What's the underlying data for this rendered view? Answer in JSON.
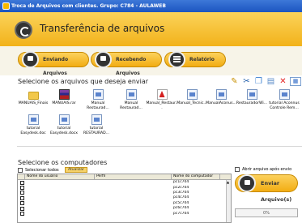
{
  "window": {
    "title": "Troca de Arquivos com clientes.    Grupo: C784 - AULAWEB"
  },
  "header": {
    "title": "Transferência de arquivos"
  },
  "tabs": [
    {
      "label": "Enviando Arquivos"
    },
    {
      "label": "Recebendo Arquivos"
    },
    {
      "label": "Relatório"
    }
  ],
  "files_section": {
    "label": "Selecione os arquivos que deseja enviar",
    "toolbar_icons": [
      "edit-icon",
      "cut-icon",
      "copy-icon",
      "paste-icon",
      "delete-icon",
      "view-icon",
      "dropdown-icon"
    ],
    "files": [
      {
        "name": "MANUAIS_Finais",
        "icon": "folder"
      },
      {
        "name": "MANUAIS.rar",
        "icon": "rar"
      },
      {
        "name": "Manual Restaurad...",
        "icon": "doc"
      },
      {
        "name": "Manual Restaurad...",
        "icon": "doc"
      },
      {
        "name": "Manual_Restaur...",
        "icon": "pdf"
      },
      {
        "name": "Manual_Tecnic...",
        "icon": "doc"
      },
      {
        "name": "ManualAconus...",
        "icon": "doc"
      },
      {
        "name": "RestauradorWi...",
        "icon": "doc"
      },
      {
        "name": "tutorial Aconnus Controle Rem...",
        "icon": "doc"
      },
      {
        "name": "tutorial Easydesk.doc",
        "icon": "doc"
      },
      {
        "name": "tutorial Easydesk.docx",
        "icon": "doc"
      },
      {
        "name": "tutorial RESTAURAD...",
        "icon": "doc"
      }
    ]
  },
  "computers_section": {
    "label": "Selecione os computadores",
    "select_all_label": "Selecionar todos",
    "refresh_label": "Atualizar",
    "columns": [
      "",
      "Nome do usuário",
      "Perfil",
      "Nome do computador"
    ],
    "rows": [
      {
        "user": "",
        "profile": "",
        "computer": "pc1c704"
      },
      {
        "user": "",
        "profile": "",
        "computer": "pc2c704"
      },
      {
        "user": "",
        "profile": "",
        "computer": "pc3c704"
      },
      {
        "user": "",
        "profile": "",
        "computer": "pc4c704"
      },
      {
        "user": "",
        "profile": "",
        "computer": "pc5c704"
      },
      {
        "user": "",
        "profile": "",
        "computer": "pc6c704"
      },
      {
        "user": "",
        "profile": "",
        "computer": "pc7c704"
      }
    ]
  },
  "send_panel": {
    "open_after_send_label": "Abrir arquivo após envio",
    "send_button_label": "Enviar Arquivo(s)",
    "progress_text": "0%",
    "progress_value": 0
  }
}
